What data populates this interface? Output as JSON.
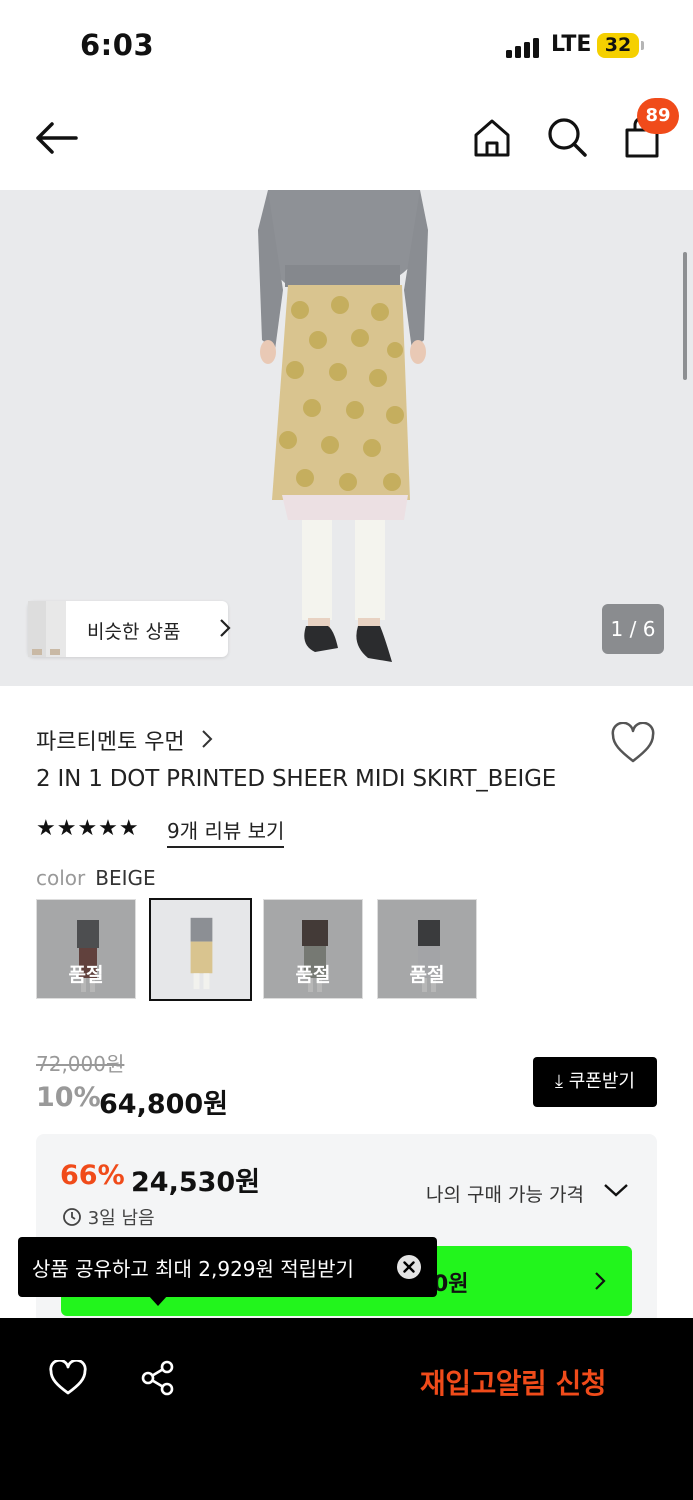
{
  "status_bar": {
    "time": "6:03",
    "network": "LTE",
    "battery": "32"
  },
  "nav": {
    "cart_count": "89"
  },
  "hero": {
    "similar_label": "비슷한 상품",
    "pager": "1 / 6"
  },
  "product": {
    "brand": "파르티멘토 우먼",
    "title": "2 IN 1 DOT PRINTED SHEER MIDI SKIRT_BEIGE",
    "rating_stars": "★★★★★",
    "rating": 5,
    "reviews_label": "9개 리뷰 보기",
    "color_key": "color",
    "color_value": "BEIGE",
    "swatches": [
      {
        "sold_out_label": "품절",
        "sold_out": true
      },
      {
        "selected": true,
        "sold_out": false
      },
      {
        "sold_out_label": "품절",
        "sold_out": true
      },
      {
        "sold_out_label": "품절",
        "sold_out": true
      }
    ],
    "original_price": "72,000원",
    "discount": "10%",
    "price": "64,800원",
    "coupon_label": "쿠폰받기"
  },
  "member_price": {
    "percent": "66%",
    "amount": "24,530원",
    "days_left": "3일 남음",
    "my_price_label": "나의 구매 가능 가격",
    "green_button_partial": "0원"
  },
  "tooltip": {
    "text": "상품 공유하고 최대 2,929원 적립받기"
  },
  "bottom_bar": {
    "restock_label": "재입고알림 신청"
  },
  "colors": {
    "accent_orange": "#f04b1a",
    "green": "#22f51c",
    "black": "#000000"
  }
}
